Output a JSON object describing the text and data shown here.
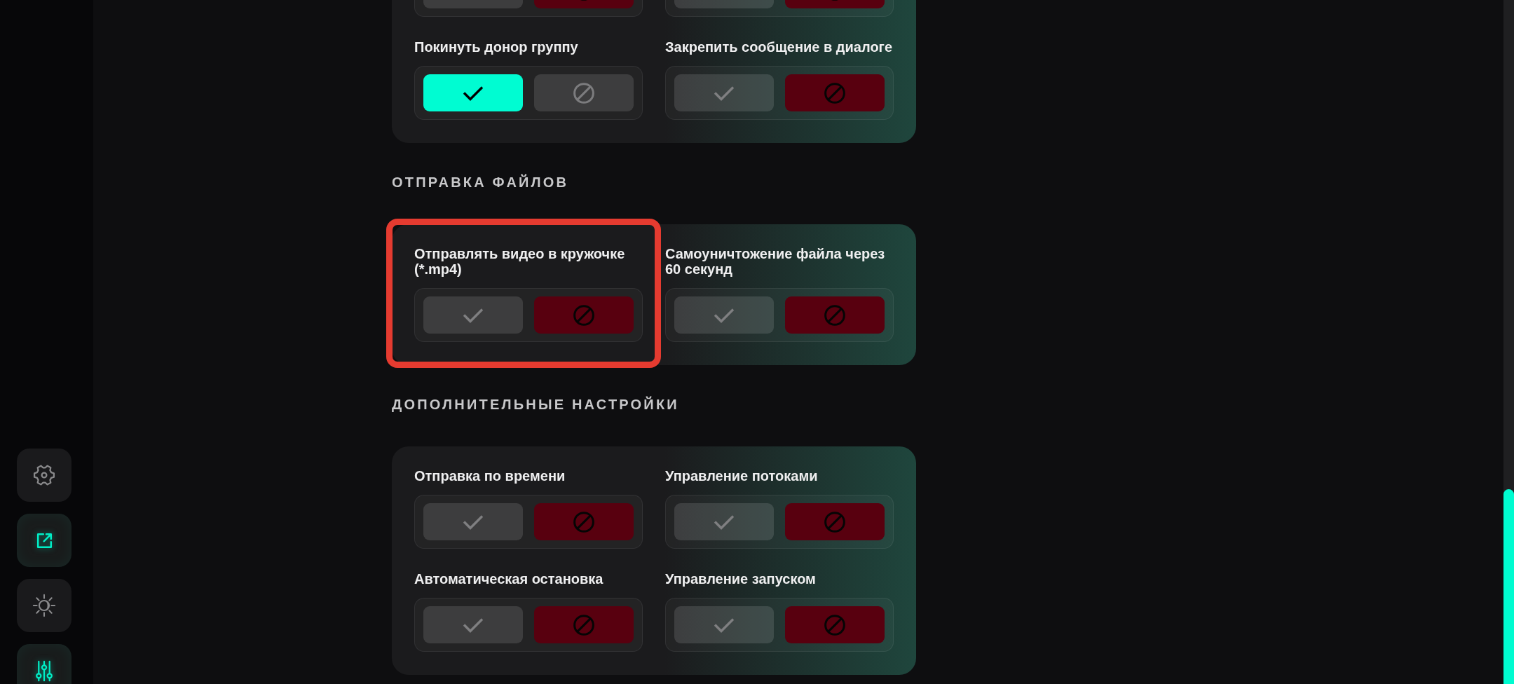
{
  "sidebar": {
    "items": [
      {
        "kind": "settings",
        "selected": false
      },
      {
        "kind": "export",
        "selected": true
      },
      {
        "kind": "theme",
        "selected": false
      },
      {
        "kind": "filters",
        "selected": true
      }
    ]
  },
  "sections": [
    {
      "items": [
        {
          "on": false,
          "highlighted": false
        },
        {
          "on": false,
          "highlighted": false
        },
        {
          "label": "Покинуть донор группу",
          "on": true,
          "highlighted": false
        },
        {
          "label": "Закрепить сообщение в диалоге",
          "on": false,
          "highlighted": false
        }
      ]
    },
    {
      "title": "ОТПРАВКА ФАЙЛОВ",
      "items": [
        {
          "label": "Отправлять видео в кружочке (*.mp4)",
          "on": false,
          "highlighted": true
        },
        {
          "label": "Самоуничтожение файла через 60 секунд",
          "on": false,
          "highlighted": false
        }
      ]
    },
    {
      "title": "ДОПОЛНИТЕЛЬНЫЕ НАСТРОЙКИ",
      "items": [
        {
          "label": "Отправка по времени",
          "on": false,
          "highlighted": false
        },
        {
          "label": "Управление потоками",
          "on": false,
          "highlighted": false
        },
        {
          "label": "Автоматическая остановка",
          "on": false,
          "highlighted": false
        },
        {
          "label": "Управление запуском",
          "on": false,
          "highlighted": false
        }
      ]
    }
  ]
}
